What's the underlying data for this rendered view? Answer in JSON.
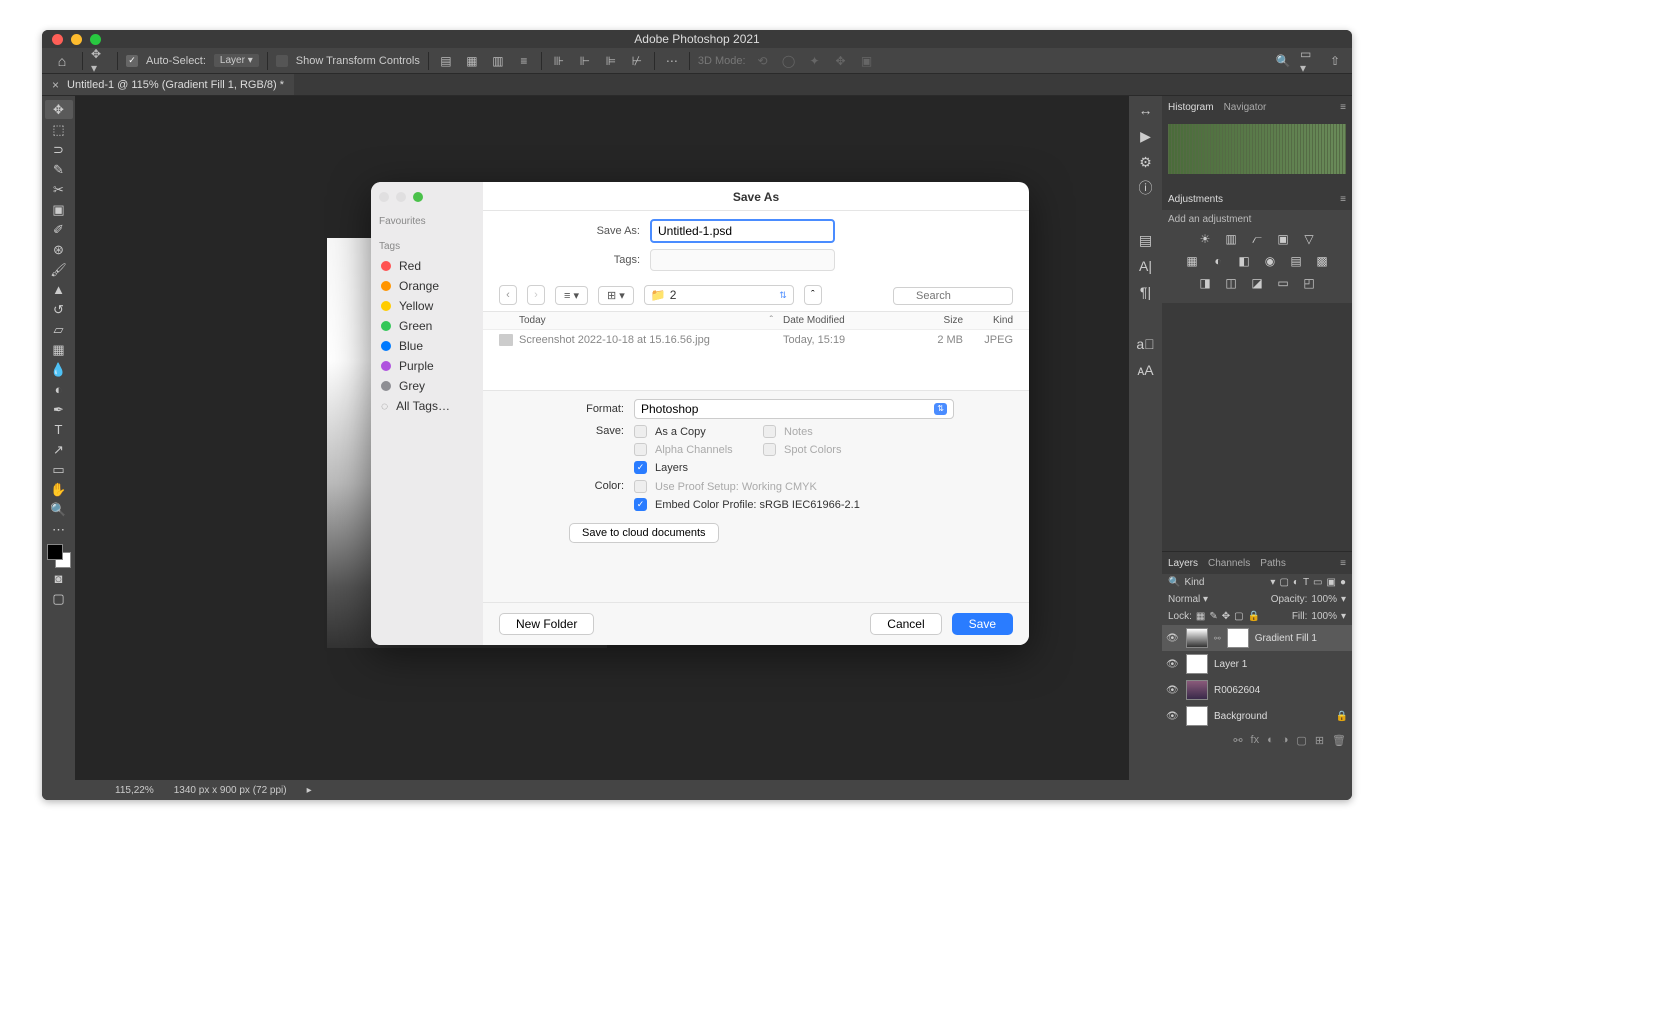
{
  "app": {
    "title": "Adobe Photoshop 2021"
  },
  "option_bar": {
    "auto_select": "Auto-Select:",
    "auto_select_target": "Layer",
    "show_transform": "Show Transform Controls",
    "mode3d": "3D Mode:"
  },
  "document_tab": {
    "label": "Untitled-1 @ 115% (Gradient Fill 1, RGB/8) *"
  },
  "status_bar": {
    "zoom": "115,22%",
    "dims": "1340 px x 900 px (72 ppi)"
  },
  "panels": {
    "histogram_tab": "Histogram",
    "navigator_tab": "Navigator",
    "adjustments_tab": "Adjustments",
    "adjustments_hint": "Add an adjustment",
    "layers_tab": "Layers",
    "channels_tab": "Channels",
    "paths_tab": "Paths"
  },
  "layers_panel": {
    "kind_label": "Kind",
    "blend_mode": "Normal",
    "opacity_label": "Opacity:",
    "opacity_value": "100%",
    "lock_label": "Lock:",
    "fill_label": "Fill:",
    "fill_value": "100%",
    "layers": [
      {
        "name": "Gradient Fill 1",
        "thumb": "grad",
        "mask": true,
        "locked": false
      },
      {
        "name": "Layer 1",
        "thumb": "white",
        "mask": false,
        "locked": false
      },
      {
        "name": "R0062604",
        "thumb": "img",
        "mask": false,
        "locked": false
      },
      {
        "name": "Background",
        "thumb": "white",
        "mask": false,
        "locked": true
      }
    ]
  },
  "dialog": {
    "title": "Save As",
    "sidebar": {
      "favourites": "Favourites",
      "tags_label": "Tags",
      "tags": [
        {
          "name": "Red",
          "color": "#ff5252"
        },
        {
          "name": "Orange",
          "color": "#ff9500"
        },
        {
          "name": "Yellow",
          "color": "#ffcc00"
        },
        {
          "name": "Green",
          "color": "#34c759"
        },
        {
          "name": "Blue",
          "color": "#007aff"
        },
        {
          "name": "Purple",
          "color": "#af52de"
        },
        {
          "name": "Grey",
          "color": "#8e8e93"
        }
      ],
      "all_tags": "All Tags…"
    },
    "saveas_label": "Save As:",
    "saveas_value": "Untitled-1.psd",
    "tags_field_label": "Tags:",
    "current_folder": "2",
    "search_placeholder": "Search",
    "columns": {
      "name": "Today",
      "date": "Date Modified",
      "size": "Size",
      "kind": "Kind"
    },
    "file_row": {
      "name": "Screenshot 2022-10-18 at 15.16.56.jpg",
      "date": "Today, 15:19",
      "size": "2 MB",
      "kind": "JPEG"
    },
    "format_label": "Format:",
    "format_value": "Photoshop",
    "save_label": "Save:",
    "color_label": "Color:",
    "opts": {
      "as_copy": "As a Copy",
      "notes": "Notes",
      "alpha": "Alpha Channels",
      "spot": "Spot Colors",
      "layers": "Layers",
      "proof": "Use Proof Setup:  Working CMYK",
      "embed": "Embed Color Profile:  sRGB IEC61966-2.1"
    },
    "cloud_btn": "Save to cloud documents",
    "new_folder": "New Folder",
    "cancel": "Cancel",
    "save": "Save"
  }
}
